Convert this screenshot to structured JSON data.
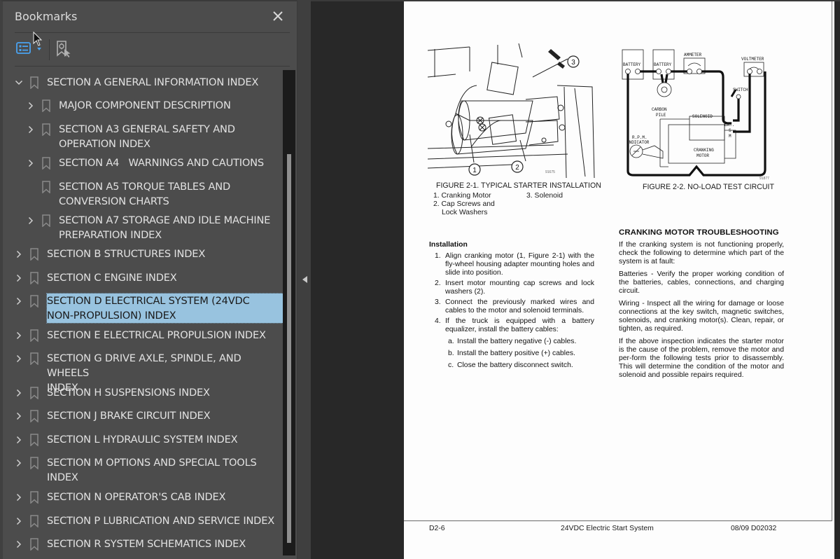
{
  "bookmarks_panel": {
    "title": "Bookmarks",
    "close_icon": "close-icon",
    "toolbar": {
      "options_icon": "bookmark-options-list-icon",
      "find_icon": "find-current-bookmark-icon"
    },
    "items": [
      {
        "label": "SECTION A GENERAL INFORMATION INDEX",
        "level": 0,
        "expander": "expanded",
        "selected": false
      },
      {
        "label": "MAJOR COMPONENT DESCRIPTION",
        "level": 1,
        "expander": "collapsed",
        "selected": false
      },
      {
        "label": "SECTION A3 GENERAL SAFETY AND\nOPERATION INDEX",
        "level": 1,
        "expander": "collapsed",
        "selected": false
      },
      {
        "label": "SECTION A4   WARNINGS AND CAUTIONS",
        "level": 1,
        "expander": "collapsed",
        "selected": false
      },
      {
        "label": "SECTION A5 TORQUE TABLES AND\nCONVERSION CHARTS",
        "level": 1,
        "expander": "none",
        "selected": false
      },
      {
        "label": "SECTION A7 STORAGE AND IDLE MACHINE\nPREPARATION INDEX",
        "level": 1,
        "expander": "collapsed",
        "selected": false
      },
      {
        "label": "SECTION B STRUCTURES INDEX",
        "level": 0,
        "expander": "collapsed",
        "selected": false
      },
      {
        "label": "SECTION C ENGINE INDEX",
        "level": 0,
        "expander": "collapsed",
        "selected": false
      },
      {
        "label": "SECTION D ELECTRICAL SYSTEM (24VDC\nNON-PROPULSION) INDEX",
        "level": 0,
        "expander": "collapsed",
        "selected": true
      },
      {
        "label": "SECTION E ELECTRICAL PROPULSION INDEX",
        "level": 0,
        "expander": "collapsed",
        "selected": false
      },
      {
        "label": "SECTION G DRIVE AXLE, SPINDLE, AND WHEELS\nINDEX",
        "level": 0,
        "expander": "collapsed",
        "selected": false
      },
      {
        "label": "SECTION H SUSPENSIONS INDEX",
        "level": 0,
        "expander": "collapsed",
        "selected": false
      },
      {
        "label": "SECTION J BRAKE CIRCUIT INDEX",
        "level": 0,
        "expander": "collapsed",
        "selected": false
      },
      {
        "label": "SECTION L HYDRAULIC SYSTEM INDEX",
        "level": 0,
        "expander": "collapsed",
        "selected": false
      },
      {
        "label": "SECTION M OPTIONS AND SPECIAL TOOLS\nINDEX",
        "level": 0,
        "expander": "collapsed",
        "selected": false
      },
      {
        "label": "SECTION N OPERATOR'S CAB INDEX",
        "level": 0,
        "expander": "collapsed",
        "selected": false
      },
      {
        "label": "SECTION P LUBRICATION AND SERVICE INDEX",
        "level": 0,
        "expander": "collapsed",
        "selected": false
      },
      {
        "label": "SECTION R SYSTEM SCHEMATICS INDEX",
        "level": 0,
        "expander": "collapsed",
        "selected": false
      }
    ]
  },
  "colors": {
    "selection": "#98c3df",
    "accent": "#4aa3f0",
    "panel_bg": "#4c4c4c",
    "viewer_bg": "#282828"
  },
  "document": {
    "figure1": {
      "callouts": [
        "1",
        "2",
        "3"
      ],
      "code": "91675",
      "caption": "FIGURE 2-1. TYPICAL STARTER INSTALLATION",
      "legend": [
        "1. Cranking Motor",
        "2. Cap Screws and",
        "Lock Washers",
        "3. Solenoid"
      ]
    },
    "figure2": {
      "labels": {
        "battery1": "BATTERY",
        "battery2": "BATTERY",
        "ammeter": "AMMETER",
        "voltmeter": "VOLTMETER",
        "switch": "SWITCH",
        "carbon_pile_1": "CARBON",
        "carbon_pile_2": "PILE",
        "solenoid": "SOLENOID",
        "bat": "BAT.",
        "s": "S",
        "m": "M",
        "rpm_1": "R.P.M.",
        "rpm_2": "INDICATOR",
        "motor_1": "CRANKING",
        "motor_2": "MOTOR"
      },
      "code": "91877",
      "caption": "FIGURE 2-2. NO-LOAD TEST CIRCUIT"
    },
    "installation": {
      "heading": "Installation",
      "steps": [
        {
          "num": "1.",
          "text": "Align cranking motor (1, Figure 2-1) with the fly-wheel housing adapter mounting holes and slide into position."
        },
        {
          "num": "2.",
          "text": "Insert motor mounting cap screws and lock washers (2)."
        },
        {
          "num": "3.",
          "text": "Connect the previously marked wires and cables to the motor and solenoid terminals."
        },
        {
          "num": "4.",
          "text": "If the truck is equipped with a battery equalizer, install the battery cables:"
        }
      ],
      "substeps": [
        {
          "num": "a.",
          "text": "Install the battery negative (-) cables."
        },
        {
          "num": "b.",
          "text": "Install the battery positive (+) cables."
        },
        {
          "num": "c.",
          "text": "Close the battery disconnect switch."
        }
      ]
    },
    "troubleshooting": {
      "heading": "CRANKING MOTOR TROUBLESHOOTING",
      "paragraphs": [
        "If the cranking system is not functioning properly, check the following to determine which part of the system is at fault:",
        "Batteries - Verify the proper working condition of the batteries, cables, connections, and charging circuit.",
        "Wiring - Inspect all the wiring for damage or loose connections at the key switch, magnetic switches, solenoids, and cranking motor(s). Clean, repair, or tighten, as required.",
        "If the above inspection indicates the starter motor is the cause of the problem, remove the motor and per-form the following tests prior to disassembly. This will determine the condition of the motor and solenoid and possible repairs required."
      ]
    },
    "footer": {
      "page_number": "D2-6",
      "title": "24VDC Electric Start System",
      "revision": "08/09  D02032"
    }
  },
  "scrollbar": {
    "position_fraction": 0.17,
    "visible_fraction": 0.8
  }
}
